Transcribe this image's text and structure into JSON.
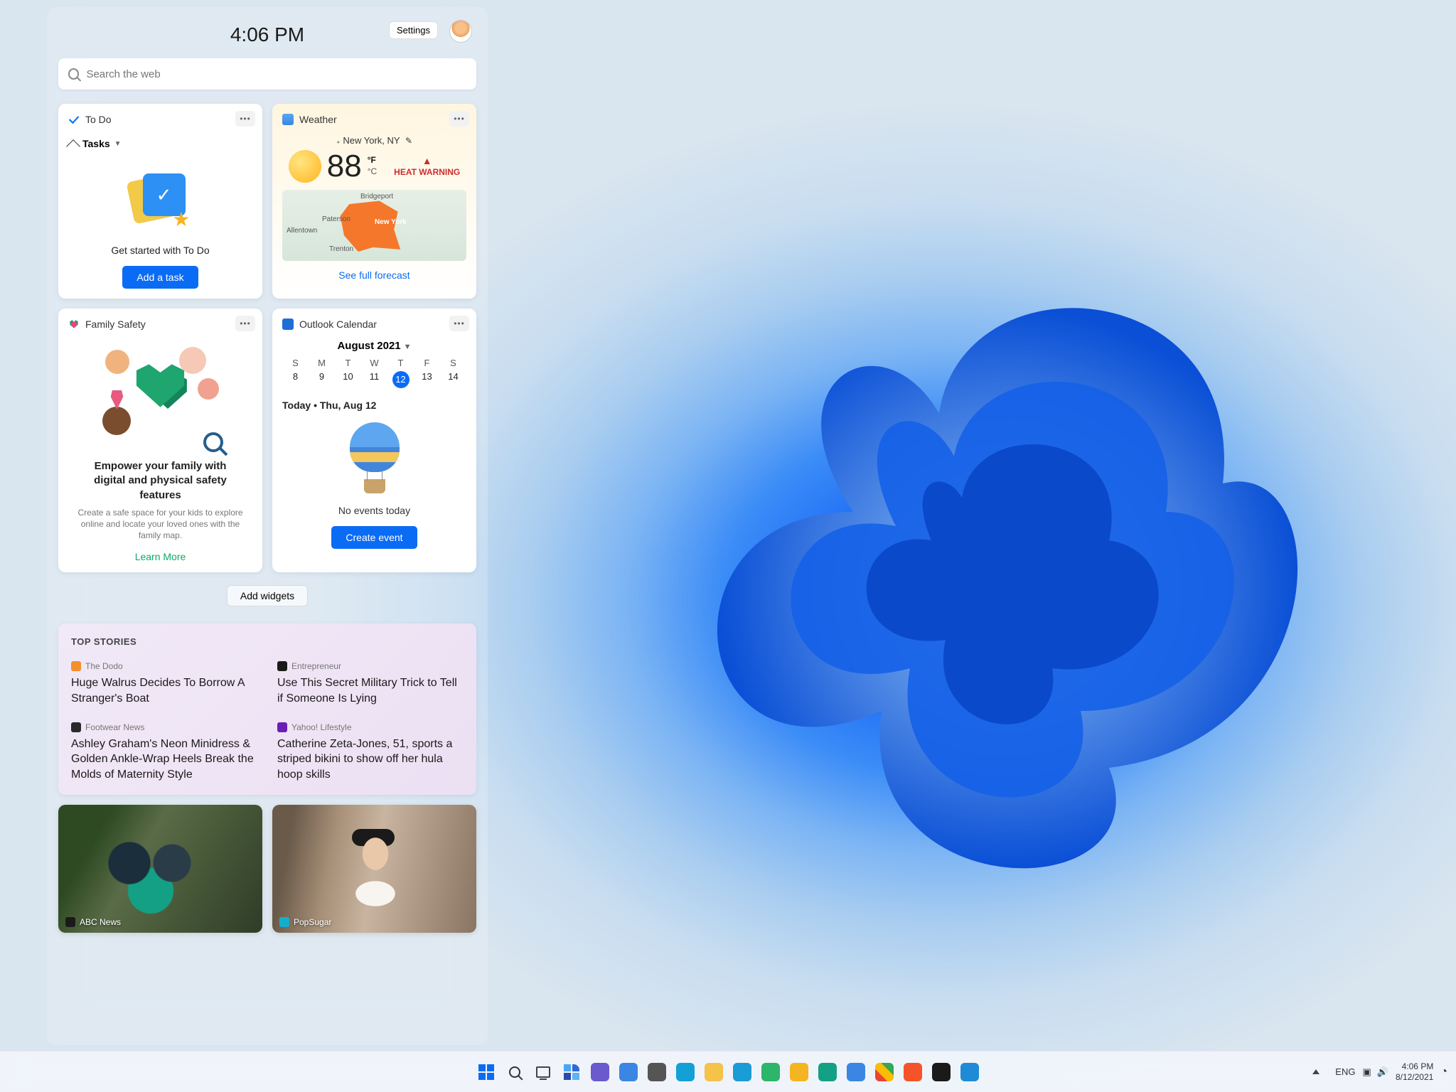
{
  "panel": {
    "time": "4:06 PM",
    "settings_label": "Settings",
    "search_placeholder": "Search the web"
  },
  "todo": {
    "title": "To Do",
    "tasks_label": "Tasks",
    "get_started": "Get started with To Do",
    "add_task": "Add a task"
  },
  "weather": {
    "title": "Weather",
    "location": "New York, NY",
    "temp": "88",
    "unit_f": "°F",
    "unit_c": "°C",
    "warning": "HEAT WARNING",
    "map_labels": {
      "bridgeport": "Bridgeport",
      "paterson": "Paterson",
      "newyork": "New York",
      "allentown": "Allentown",
      "trenton": "Trenton"
    },
    "forecast_link": "See full forecast"
  },
  "family": {
    "title": "Family Safety",
    "headline": "Empower your family with digital and physical safety features",
    "sub": "Create a safe space for your kids to explore online and locate your loved ones with the family map.",
    "learn_more": "Learn More"
  },
  "calendar": {
    "title": "Outlook Calendar",
    "month": "August 2021",
    "days": [
      "S",
      "M",
      "T",
      "W",
      "T",
      "F",
      "S"
    ],
    "dates": [
      "8",
      "9",
      "10",
      "11",
      "12",
      "13",
      "14"
    ],
    "today_index": 4,
    "today_label": "Today • Thu, Aug 12",
    "no_events": "No events today",
    "create_event": "Create event"
  },
  "add_widgets": "Add widgets",
  "news": {
    "header": "TOP STORIES",
    "items": [
      {
        "source": "The Dodo",
        "color": "#f58f2a",
        "headline": "Huge Walrus Decides To Borrow A Stranger's Boat"
      },
      {
        "source": "Entrepreneur",
        "color": "#1a1a1a",
        "headline": "Use This Secret Military Trick to Tell if Someone Is Lying"
      },
      {
        "source": "Footwear News",
        "color": "#2a2a2a",
        "headline": "Ashley Graham's Neon Minidress & Golden Ankle-Wrap Heels Break the Molds of Maternity Style"
      },
      {
        "source": "Yahoo! Lifestyle",
        "color": "#6a1eb5",
        "headline": "Catherine Zeta-Jones, 51, sports a striped bikini to show off her hula hoop skills"
      }
    ]
  },
  "photos": [
    {
      "source": "ABC News",
      "color": "#1a1a1a"
    },
    {
      "source": "PopSugar",
      "color": "#14aecc"
    }
  ],
  "taskbar": {
    "apps": [
      "start",
      "search",
      "taskview",
      "widgets",
      "chat",
      "mail",
      "settings",
      "store",
      "explorer",
      "edge",
      "edge-dev",
      "chrome-canary",
      "edge-beta",
      "chrome-dev",
      "chrome",
      "brave",
      "terminal",
      "code"
    ],
    "tray": {
      "lang": "ENG",
      "time": "4:06 PM",
      "date": "8/12/2021"
    }
  }
}
